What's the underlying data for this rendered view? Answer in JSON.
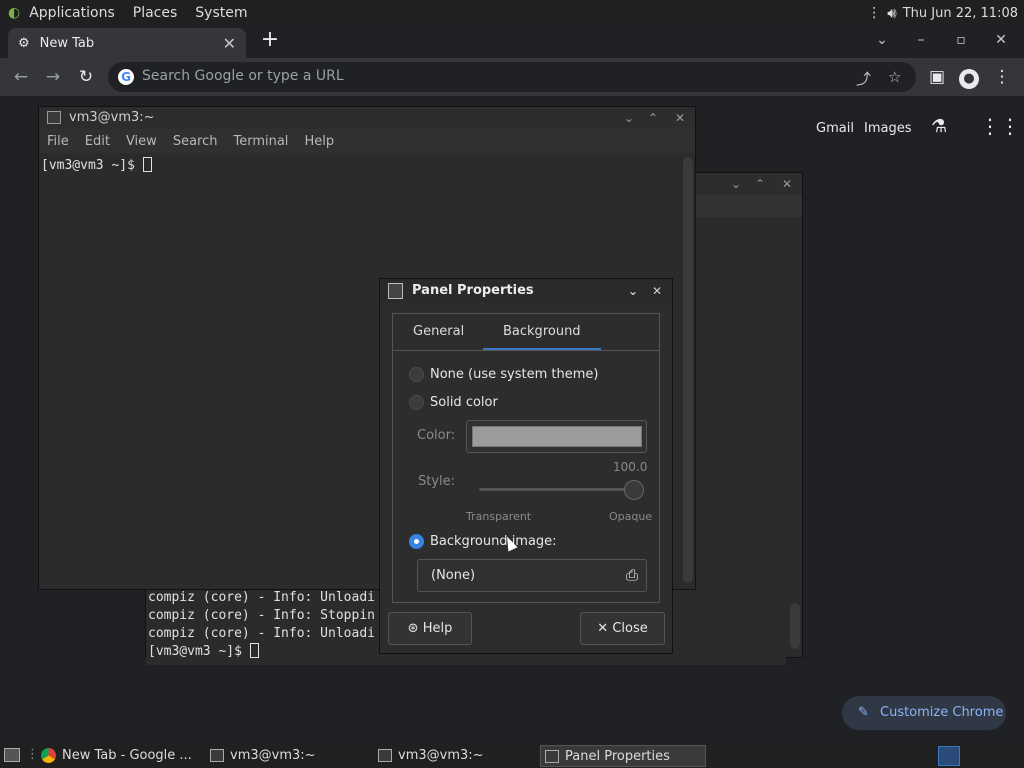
{
  "top_panel": {
    "menus": [
      "Applications",
      "Places",
      "System"
    ],
    "clock": "Thu Jun 22, 11:08"
  },
  "chrome": {
    "tab_title": "New Tab",
    "omnibox_placeholder": "Search Google or type a URL",
    "links": {
      "gmail": "Gmail",
      "images": "Images"
    },
    "customize": "Customize Chrome"
  },
  "terminal_front": {
    "title": "vm3@vm3:~",
    "menu": [
      "File",
      "Edit",
      "View",
      "Search",
      "Terminal",
      "Help"
    ],
    "prompt": "[vm3@vm3 ~]$ "
  },
  "terminal_back": {
    "lines": [
      "compiz (core) - Info: Unloadi",
      "compiz (core) - Info: Stoppin",
      "compiz (core) - Info: Unloadi"
    ],
    "prompt": "[vm3@vm3 ~]$ "
  },
  "dialog": {
    "title": "Panel Properties",
    "tabs": [
      "General",
      "Background"
    ],
    "active_tab": "Background",
    "radio_none": "None (use system theme)",
    "radio_solid": "Solid color",
    "color_label": "Color:",
    "color_value": "#9b9b9b",
    "style_label": "Style:",
    "style_value": "100.0",
    "transparent": "Transparent",
    "opaque": "Opaque",
    "radio_image": "Background image:",
    "selected_radio": "Background image:",
    "file_value": "(None)",
    "help": "Help",
    "close": "Close"
  },
  "taskbar": {
    "tasks": [
      "New Tab - Google ...",
      "vm3@vm3:~",
      "vm3@vm3:~",
      "Panel Properties"
    ]
  }
}
